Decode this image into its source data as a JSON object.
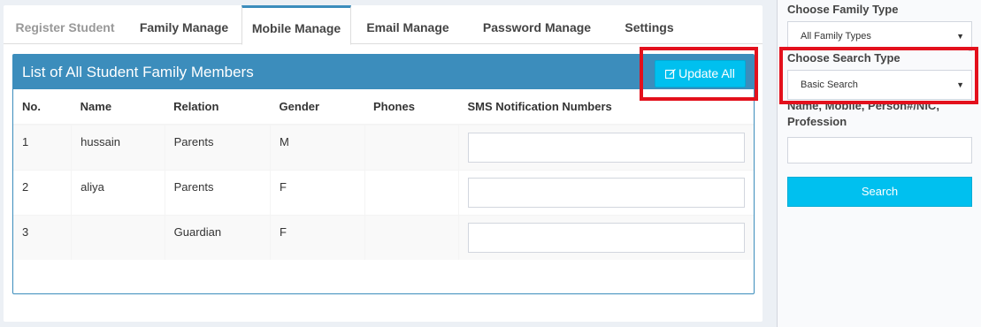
{
  "tabs": [
    {
      "label": "Register Student"
    },
    {
      "label": "Family Manage"
    },
    {
      "label": "Mobile Manage"
    },
    {
      "label": "Email Manage"
    },
    {
      "label": "Password Manage"
    },
    {
      "label": "Settings"
    }
  ],
  "panel": {
    "title": "List of All Student Family Members",
    "update_label": "Update All",
    "update_icon": "edit-icon"
  },
  "table": {
    "headers": [
      "No.",
      "Name",
      "Relation",
      "Gender",
      "Phones",
      "SMS Notification Numbers"
    ],
    "rows": [
      {
        "no": "1",
        "name": "hussain",
        "relation": "Parents",
        "gender": "M",
        "phones": "",
        "sms": ""
      },
      {
        "no": "2",
        "name": "aliya",
        "relation": "Parents",
        "gender": "F",
        "phones": "",
        "sms": ""
      },
      {
        "no": "3",
        "name": "",
        "relation": "Guardian",
        "gender": "F",
        "phones": "",
        "sms": ""
      }
    ]
  },
  "sidebar": {
    "family_type_label": "Choose Family Type",
    "family_type_value": "All Family Types",
    "search_type_label": "Choose Search Type",
    "search_type_value": "Basic Search",
    "query_label": "Name, Mobile, Person#/NIC, Profession",
    "query_value": "",
    "search_label": "Search"
  },
  "colors": {
    "primary": "#3c8dbc",
    "info": "#00c0ef",
    "highlight": "#e3101c"
  }
}
